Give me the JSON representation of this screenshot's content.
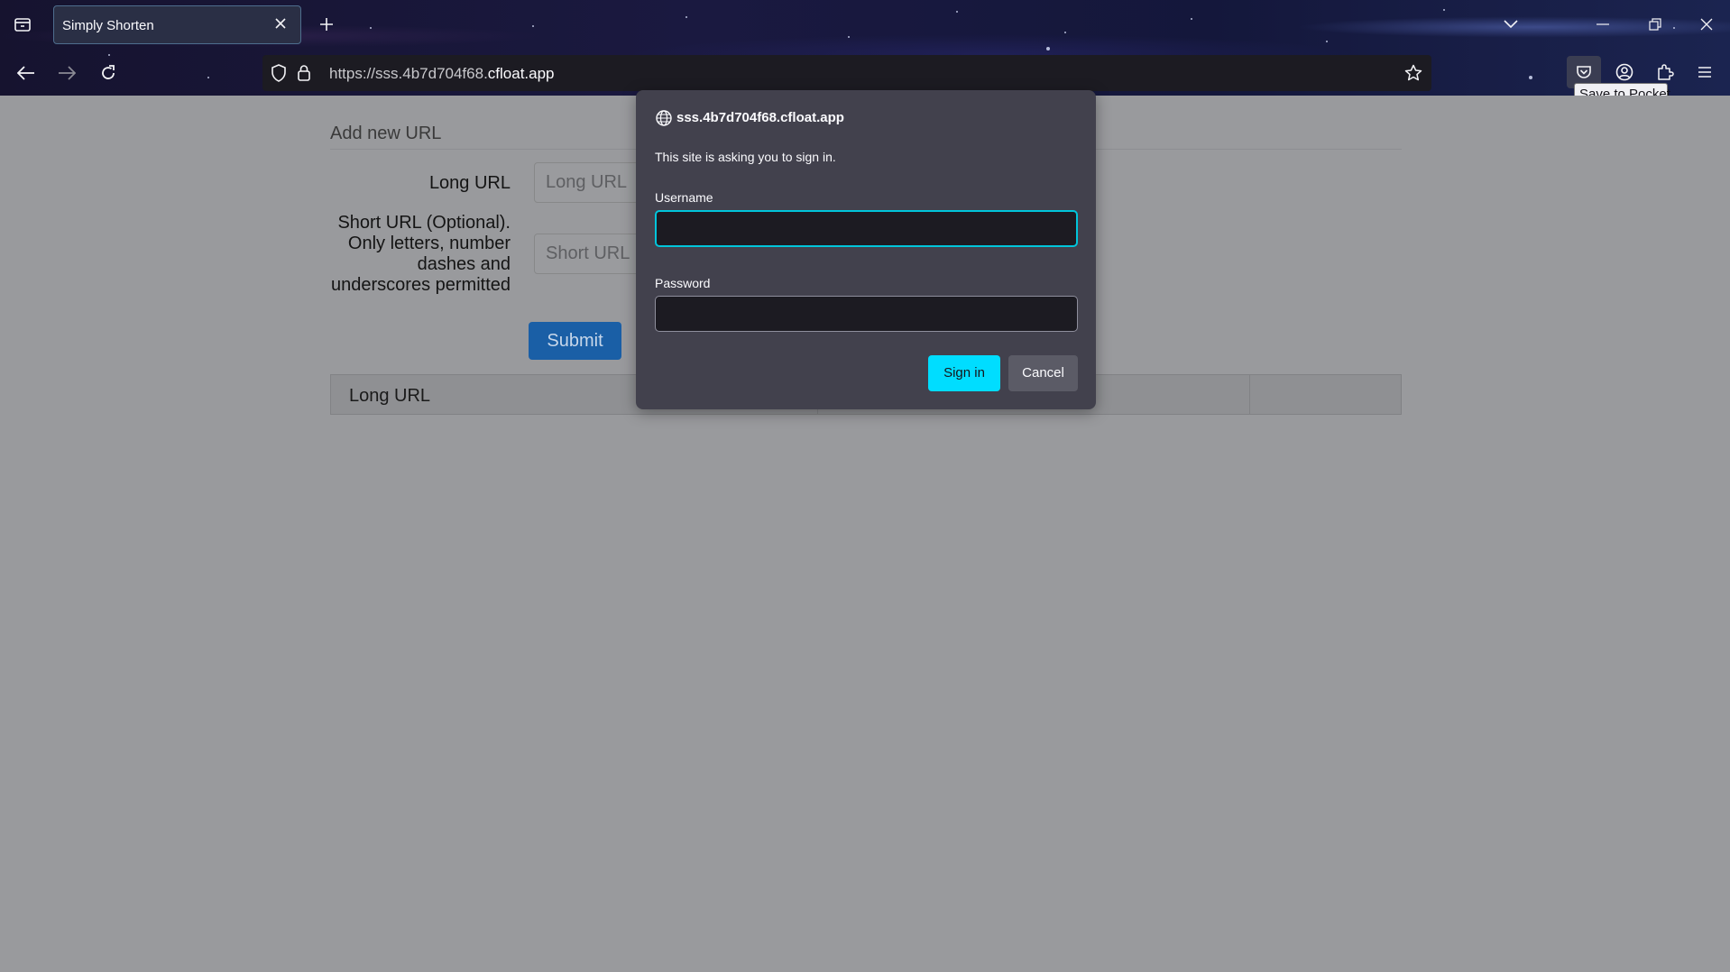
{
  "browser": {
    "tab_title": "Simply Shorten",
    "url_scheme": "https://sss.4b7d704f68.",
    "url_host": "cfloat.app",
    "tooltip": "Save to Pocket",
    "icons": [
      "tab-list-icon",
      "close-icon",
      "new-tab-icon",
      "chevron-down-icon",
      "minimize-icon",
      "restore-icon",
      "window-close-icon",
      "back-icon",
      "forward-icon",
      "reload-icon",
      "shield-icon",
      "lock-icon",
      "star-icon",
      "pocket-icon",
      "account-icon",
      "extensions-icon",
      "menu-icon"
    ]
  },
  "page": {
    "section_title": "Add new URL",
    "long_url_label": "Long URL",
    "long_url_placeholder": "Long URL",
    "short_url_label_lines": [
      "Short URL (Optional).",
      "Only letters, number",
      "dashes and",
      "underscores permitted"
    ],
    "short_url_placeholder": "Short URL",
    "submit_label": "Submit",
    "table_headers": [
      "Long URL"
    ]
  },
  "dialog": {
    "host": "sss.4b7d704f68.cfloat.app",
    "message": "This site is asking you to sign in.",
    "username_label": "Username",
    "username_value": "",
    "password_label": "Password",
    "password_value": "",
    "sign_in_label": "Sign in",
    "cancel_label": "Cancel",
    "accent_color": "#00ddff"
  }
}
